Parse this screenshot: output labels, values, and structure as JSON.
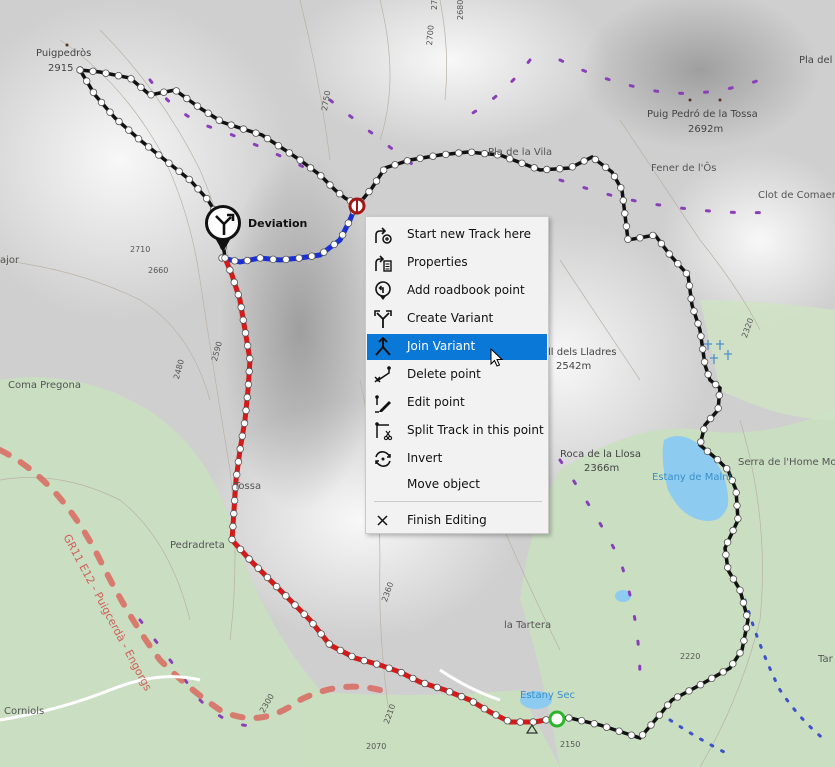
{
  "map": {
    "labels": {
      "puigpedros": "Puigpedròs",
      "puigpedros_elev": "2915",
      "pla_del": "Pla del",
      "puig_pedro": "Puig Pedró de la Tossa",
      "puig_pedro_elev": "2692m",
      "pla_vila": "Pla de la Vila",
      "fener": "Fener de l'Ôs",
      "clot": "Clot de Comaer",
      "ajor": "ajor",
      "coma_pregona": "Coma Pregona",
      "lladres": "ll dels Lladres",
      "lladres_elev": "2542m",
      "roca": "Roca de la Llosa",
      "roca_elev": "2366m",
      "serra": "Serra de l'Home Mort",
      "estany_malni": "Estany de Malni",
      "tossa": "Tossa",
      "pedradreta": "Pedradreta",
      "la_tartera": "la Tartera",
      "estany_sec": "Estany Sec",
      "corniols": "Corniols",
      "trail": "GR11 E12 - Puigcerdà - Engorgs",
      "tar": "Tar"
    },
    "contours": [
      "2700",
      "2680",
      "2750",
      "2700",
      "2710",
      "2660",
      "2590",
      "2480",
      "2360",
      "2320",
      "2220",
      "2300",
      "2210",
      "2070",
      "2150"
    ]
  },
  "deviation": {
    "label": "Deviation",
    "icon": "deviation-icon"
  },
  "menu": {
    "items": [
      {
        "label": "Start new Track here",
        "icon": "new-track-icon"
      },
      {
        "label": "Properties",
        "icon": "properties-icon"
      },
      {
        "label": "Add roadbook point",
        "icon": "roadbook-icon"
      },
      {
        "label": "Create Variant",
        "icon": "variant-icon"
      },
      {
        "label": "Join Variant",
        "icon": "join-variant-icon"
      },
      {
        "label": "Delete point",
        "icon": "delete-point-icon"
      },
      {
        "label": "Edit point",
        "icon": "edit-point-icon"
      },
      {
        "label": "Split Track in this point",
        "icon": "split-track-icon"
      },
      {
        "label": "Invert",
        "icon": "invert-icon"
      },
      {
        "label": "Move object",
        "icon": ""
      },
      {
        "label": "Finish Editing",
        "icon": "close-icon"
      }
    ],
    "active_index": 4
  },
  "colors": {
    "track_main": "#111111",
    "track_variant": "#1a2fd6",
    "track_red": "#d51a1a",
    "lake": "#8ecbf0",
    "forest": "#c7dfbc",
    "menu_highlight": "#0a78d7"
  }
}
